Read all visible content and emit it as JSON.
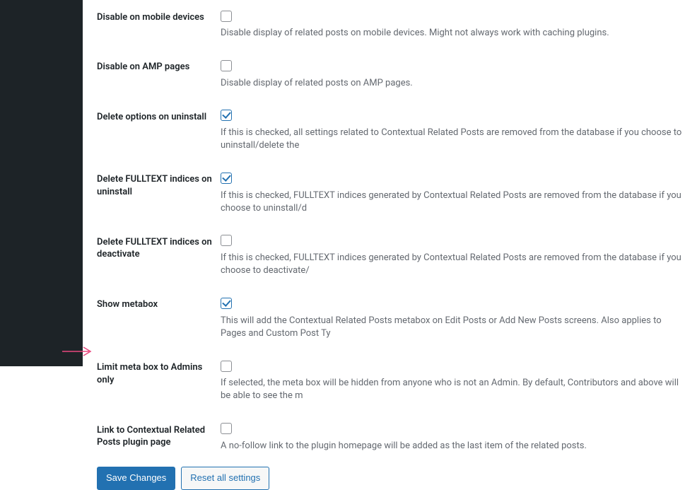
{
  "settings": [
    {
      "label": "Disable on mobile devices",
      "checked": false,
      "description": "Disable display of related posts on mobile devices. Might not always work with caching plugins."
    },
    {
      "label": "Disable on AMP pages",
      "checked": false,
      "description": "Disable display of related posts on AMP pages."
    },
    {
      "label": "Delete options on uninstall",
      "checked": true,
      "description": "If this is checked, all settings related to Contextual Related Posts are removed from the database if you choose to uninstall/delete the "
    },
    {
      "label": "Delete FULLTEXT indices on uninstall",
      "checked": true,
      "description": "If this is checked, FULLTEXT indices generated by Contextual Related Posts are removed from the database if you choose to uninstall/d"
    },
    {
      "label": "Delete FULLTEXT indices on deactivate",
      "checked": false,
      "description": "If this is checked, FULLTEXT indices generated by Contextual Related Posts are removed from the database if you choose to deactivate/"
    },
    {
      "label": "Show metabox",
      "checked": true,
      "description": "This will add the Contextual Related Posts metabox on Edit Posts or Add New Posts screens. Also applies to Pages and Custom Post Ty"
    },
    {
      "label": "Limit meta box to Admins only",
      "checked": false,
      "description": "If selected, the meta box will be hidden from anyone who is not an Admin. By default, Contributors and above will be able to see the m"
    },
    {
      "label": "Link to Contextual Related Posts plugin page",
      "checked": false,
      "description": "A no-follow link to the plugin homepage will be added as the last item of the related posts."
    }
  ],
  "buttons": {
    "save": "Save Changes",
    "reset": "Reset all settings"
  }
}
